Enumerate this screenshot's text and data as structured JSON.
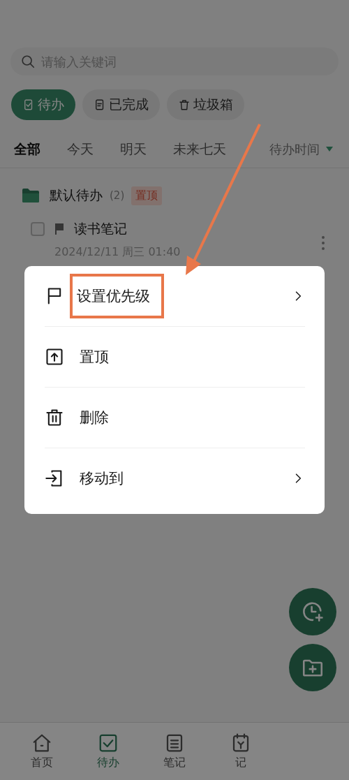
{
  "search": {
    "placeholder": "请输入关键词"
  },
  "status_tabs": [
    {
      "label": "待办",
      "selected": true
    },
    {
      "label": "已完成",
      "selected": false
    },
    {
      "label": "垃圾箱",
      "selected": false
    }
  ],
  "filters": [
    {
      "label": "全部",
      "selected": true
    },
    {
      "label": "今天",
      "selected": false
    },
    {
      "label": "明天",
      "selected": false
    },
    {
      "label": "未来七天",
      "selected": false
    }
  ],
  "sort": {
    "label": "待办时间"
  },
  "group": {
    "name": "默认待办",
    "count": "(2)",
    "badge": "置顶"
  },
  "tasks": [
    {
      "title": "读书笔记",
      "date": "2024/12/11 周三 01:40",
      "checked": false
    }
  ],
  "menu": {
    "items": [
      {
        "label": "设置优先级",
        "kind": "priority",
        "submenu": true,
        "highlighted": true
      },
      {
        "label": "置顶",
        "kind": "pin",
        "submenu": false,
        "highlighted": false
      },
      {
        "label": "删除",
        "kind": "delete",
        "submenu": false,
        "highlighted": false
      },
      {
        "label": "移动到",
        "kind": "move",
        "submenu": true,
        "highlighted": false
      }
    ]
  },
  "bottom_nav": [
    {
      "label": "首页",
      "selected": false
    },
    {
      "label": "待办",
      "selected": true
    },
    {
      "label": "笔记",
      "selected": false
    },
    {
      "label": "记",
      "selected": false
    }
  ]
}
